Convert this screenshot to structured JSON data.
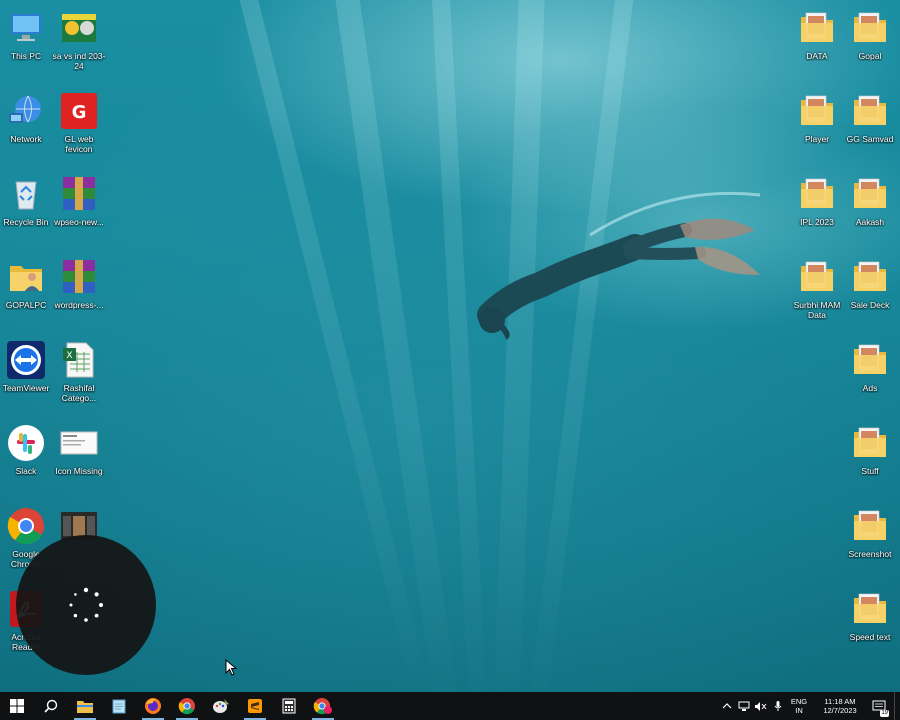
{
  "desktop": {
    "left_icons": [
      {
        "label": "This PC",
        "icon": "computer-icon"
      },
      {
        "label": "sa vs ind 203-24",
        "icon": "image-file-icon"
      },
      {
        "label": "Network",
        "icon": "network-icon"
      },
      {
        "label": "GL web fevicon",
        "icon": "favicon-icon"
      },
      {
        "label": "Recycle Bin",
        "icon": "recycle-bin-icon"
      },
      {
        "label": "wpseo-new...",
        "icon": "winrar-archive-icon"
      },
      {
        "label": "GOPALPC",
        "icon": "user-folder-icon"
      },
      {
        "label": "wordpress-...",
        "icon": "winrar-archive-icon"
      },
      {
        "label": "TeamViewer",
        "icon": "teamviewer-icon"
      },
      {
        "label": "Rashifal Catego...",
        "icon": "excel-file-icon"
      },
      {
        "label": "Slack",
        "icon": "slack-icon"
      },
      {
        "label": "Icon Missing",
        "icon": "screenshot-file-icon"
      },
      {
        "label": "Google Chrome",
        "icon": "chrome-icon"
      },
      {
        "label": "",
        "icon": "photo-file-icon"
      },
      {
        "label": "Acrobat Reader",
        "icon": "acrobat-icon"
      }
    ],
    "right_icons": [
      {
        "label": "DATA",
        "icon": "folder-icon"
      },
      {
        "label": "Gopal",
        "icon": "folder-icon"
      },
      {
        "label": "Player",
        "icon": "folder-icon"
      },
      {
        "label": "GG Samvad",
        "icon": "folder-icon"
      },
      {
        "label": "IPL 2023",
        "icon": "folder-icon"
      },
      {
        "label": "Aakash",
        "icon": "folder-icon"
      },
      {
        "label": "Surbhi MAM Data",
        "icon": "folder-icon"
      },
      {
        "label": "Sale Deck",
        "icon": "folder-icon"
      },
      {
        "label": "Ads",
        "icon": "folder-icon"
      },
      {
        "label": "Stuff",
        "icon": "folder-icon"
      },
      {
        "label": "Screenshot",
        "icon": "folder-icon"
      },
      {
        "label": "Speed text",
        "icon": "folder-icon"
      }
    ]
  },
  "taskbar": {
    "pinned": [
      {
        "name": "start",
        "icon": "windows-start-icon"
      },
      {
        "name": "search",
        "icon": "search-icon"
      },
      {
        "name": "file-explorer",
        "icon": "file-explorer-icon"
      },
      {
        "name": "notepad",
        "icon": "notepad-icon"
      },
      {
        "name": "firefox",
        "icon": "firefox-icon"
      },
      {
        "name": "chrome",
        "icon": "chrome-icon"
      },
      {
        "name": "paint",
        "icon": "paint-icon"
      },
      {
        "name": "sublime-text",
        "icon": "sublime-text-icon"
      },
      {
        "name": "calculator",
        "icon": "calculator-icon"
      },
      {
        "name": "chrome-profile",
        "icon": "chrome-profile-icon"
      }
    ],
    "tray": {
      "language_line1": "ENG",
      "language_line2": "IN",
      "time": "11:18 AM",
      "date": "12/7/2023",
      "notification_count": "19"
    }
  },
  "colors": {
    "taskbar_bg": "#0f1113",
    "folder_yellow": "#f2c94c",
    "water_accent": "#178a9c"
  }
}
